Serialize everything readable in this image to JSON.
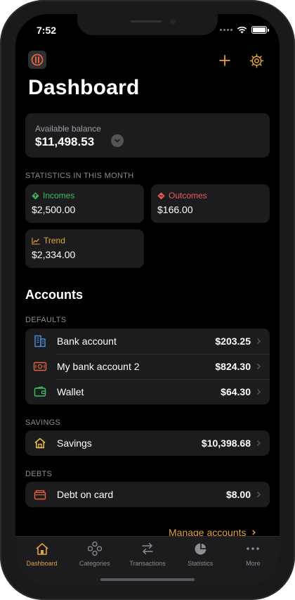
{
  "status_bar": {
    "time": "7:52"
  },
  "header": {
    "title": "Dashboard"
  },
  "balance": {
    "label": "Available balance",
    "value": "$11,498.53"
  },
  "statistics": {
    "header": "STATISTICS IN THIS MONTH",
    "incomes": {
      "label": "Incomes",
      "value": "$2,500.00",
      "color": "#3fbf5e"
    },
    "outcomes": {
      "label": "Outcomes",
      "value": "$166.00",
      "color": "#ec5a59"
    },
    "trend": {
      "label": "Trend",
      "value": "$2,334.00",
      "color": "#e3a33c"
    }
  },
  "accounts": {
    "title": "Accounts",
    "defaults_header": "DEFAULTS",
    "defaults": [
      {
        "label": "Bank account",
        "amount": "$203.25",
        "icon": "building-icon",
        "color": "#4a90e2"
      },
      {
        "label": "My bank account 2",
        "amount": "$824.30",
        "icon": "banknote-icon",
        "color": "#e2643e"
      },
      {
        "label": "Wallet",
        "amount": "$64.30",
        "icon": "wallet-icon",
        "color": "#3fbf5e"
      }
    ],
    "savings_header": "SAVINGS",
    "savings": [
      {
        "label": "Savings",
        "amount": "$10,398.68",
        "icon": "house-icon",
        "color": "#f2c53d"
      }
    ],
    "debts_header": "DEBTS",
    "debts": [
      {
        "label": "Debt on card",
        "amount": "$8.00",
        "icon": "archive-icon",
        "color": "#e2643e"
      }
    ],
    "manage_label": "Manage accounts"
  },
  "tabbar": {
    "tabs": [
      {
        "label": "Dashboard",
        "icon": "house-icon",
        "active": true
      },
      {
        "label": "Categories",
        "icon": "categories-icon"
      },
      {
        "label": "Transactions",
        "icon": "arrows-icon"
      },
      {
        "label": "Statistics",
        "icon": "pie-chart-icon"
      },
      {
        "label": "More",
        "icon": "ellipsis-icon"
      }
    ]
  },
  "colors": {
    "accent": "#e3a33c",
    "card": "#1c1c1e",
    "background": "#000000"
  }
}
